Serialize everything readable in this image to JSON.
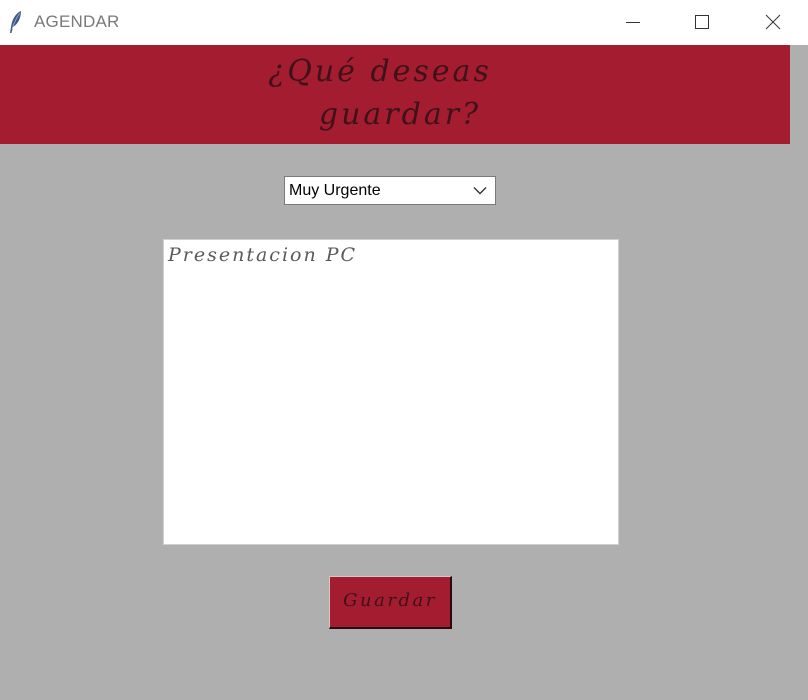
{
  "window": {
    "title": "AGENDAR",
    "icon": "feather-icon",
    "controls": [
      "minimize-icon",
      "maximize-icon",
      "close-icon"
    ]
  },
  "header": {
    "line1": "¿Qué deseas",
    "line2": "guardar?",
    "background": "#a41c30",
    "text_color": "#3e1218"
  },
  "priority_select": {
    "selected": "Muy Urgente"
  },
  "note_textarea": {
    "value": "Presentacion PC"
  },
  "save_button": {
    "label": "Guardar",
    "background": "#a41c30"
  },
  "colors": {
    "window_background": "#afafaf"
  }
}
